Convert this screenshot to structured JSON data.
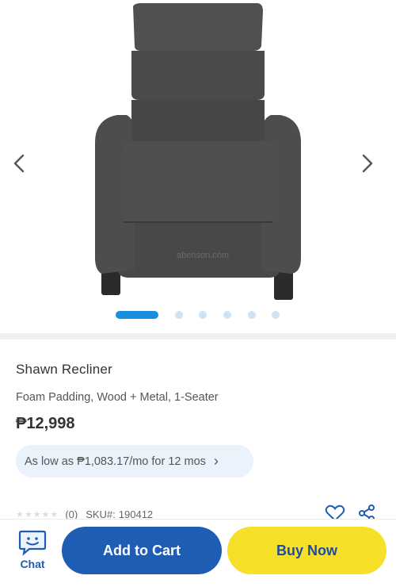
{
  "gallery": {
    "image_alt": "Shawn Recliner",
    "watermark": "abenson.com",
    "prev_icon": "chevron-left-icon",
    "next_icon": "chevron-right-icon",
    "slide_count": 6,
    "active_slide": 1
  },
  "product": {
    "title": "Shawn Recliner",
    "subtitle": "Foam Padding, Wood + Metal, 1-Seater",
    "price": "₱12,998",
    "installment": "As low as ₱1,083.17/mo for 12 mos",
    "rating_stars": "★★★★★",
    "rating_count": "(0)",
    "sku_label": "SKU#:",
    "sku": "190412"
  },
  "actions": {
    "chat_label": "Chat",
    "add_to_cart": "Add to Cart",
    "buy_now": "Buy Now",
    "wishlist_icon": "heart-icon",
    "share_icon": "share-icon"
  },
  "colors": {
    "accent_blue": "#1f5db5",
    "accent_yellow": "#f7e02a",
    "dot_active": "#1a8fe0",
    "installment_bg": "#eaf3fc"
  }
}
